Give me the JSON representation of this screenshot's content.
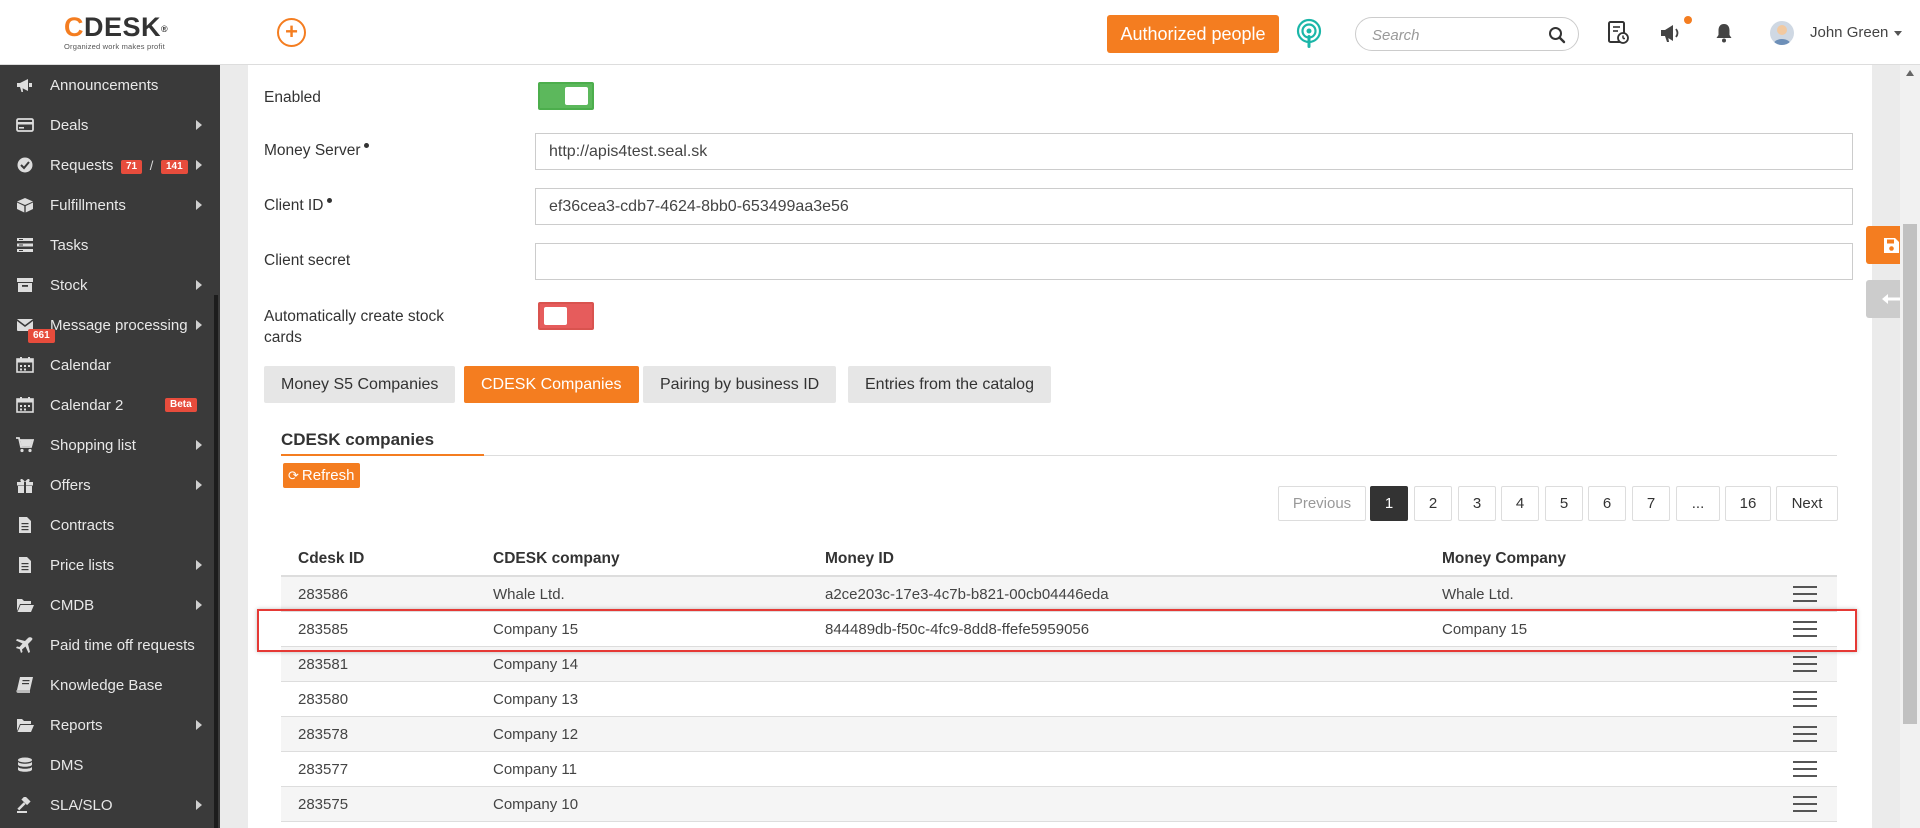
{
  "header": {
    "logo_text": "DESK",
    "logo_c": "C",
    "logo_reg": "®",
    "logo_tagline": "Organized work makes profit",
    "add_symbol": "+",
    "authorized_label": "Authorized people",
    "search_placeholder": "Search",
    "user_name": "John Green"
  },
  "sidebar": {
    "items": [
      {
        "label": "Announcements",
        "icon": "megaphone-icon"
      },
      {
        "label": "Deals",
        "icon": "card-icon"
      },
      {
        "label": "Requests",
        "icon": "check-circle-icon",
        "badge_a": "71",
        "sep": "/",
        "badge_b": "141"
      },
      {
        "label": "Fulfillments",
        "icon": "box-icon"
      },
      {
        "label": "Tasks",
        "icon": "list-icon"
      },
      {
        "label": "Stock",
        "icon": "archive-icon"
      },
      {
        "label": "Message processing",
        "icon": "envelope-icon",
        "badge": "661"
      },
      {
        "label": "Calendar",
        "icon": "calendar-icon"
      },
      {
        "label": "Calendar 2",
        "icon": "calendar-icon",
        "badge": "Beta"
      },
      {
        "label": "Shopping list",
        "icon": "cart-icon"
      },
      {
        "label": "Offers",
        "icon": "gift-icon"
      },
      {
        "label": "Contracts",
        "icon": "document-icon"
      },
      {
        "label": "Price lists",
        "icon": "document-icon"
      },
      {
        "label": "CMDB",
        "icon": "folder-open-icon"
      },
      {
        "label": "Paid time off requests",
        "icon": "plane-icon"
      },
      {
        "label": "Knowledge Base",
        "icon": "book-icon"
      },
      {
        "label": "Reports",
        "icon": "folder-open-icon"
      },
      {
        "label": "DMS",
        "icon": "database-icon"
      },
      {
        "label": "SLA/SLO",
        "icon": "gavel-icon"
      }
    ]
  },
  "form": {
    "enabled_label": "Enabled",
    "enabled_value": true,
    "money_server_label": "Money Server",
    "money_server_value": "http://apis4test.seal.sk",
    "client_id_label": "Client ID",
    "client_id_value": "ef36cea3-cdb7-4624-8bb0-653499aa3e56",
    "client_secret_label": "Client secret",
    "client_secret_value": "",
    "auto_stock_label": "Automatically create stock cards",
    "auto_stock_value": false
  },
  "tabs": [
    {
      "label": "Money S5 Companies",
      "active": false
    },
    {
      "label": "CDESK Companies",
      "active": true
    },
    {
      "label": "Pairing by business ID",
      "active": false
    },
    {
      "label": "Entries from the catalog",
      "active": false
    }
  ],
  "section": {
    "title": "CDESK companies",
    "refresh_label": "Refresh"
  },
  "pagination": {
    "previous": "Previous",
    "pages": [
      "1",
      "2",
      "3",
      "4",
      "5",
      "6",
      "7",
      "...",
      "16"
    ],
    "current": "1",
    "next": "Next"
  },
  "table": {
    "columns": [
      "Cdesk ID",
      "CDESK company",
      "Money ID",
      "Money Company"
    ],
    "rows": [
      {
        "cdesk_id": "283586",
        "cdesk_company": "Whale Ltd.",
        "money_id": "a2ce203c-17e3-4c7b-b821-00cb04446eda",
        "money_company": "Whale Ltd."
      },
      {
        "cdesk_id": "283585",
        "cdesk_company": "Company 15",
        "money_id": "844489db-f50c-4fc9-8dd8-ffefe5959056",
        "money_company": "Company 15",
        "highlighted": true
      },
      {
        "cdesk_id": "283581",
        "cdesk_company": "Company 14",
        "money_id": "",
        "money_company": ""
      },
      {
        "cdesk_id": "283580",
        "cdesk_company": "Company 13",
        "money_id": "",
        "money_company": ""
      },
      {
        "cdesk_id": "283578",
        "cdesk_company": "Company 12",
        "money_id": "",
        "money_company": ""
      },
      {
        "cdesk_id": "283577",
        "cdesk_company": "Company 11",
        "money_id": "",
        "money_company": ""
      },
      {
        "cdesk_id": "283575",
        "cdesk_company": "Company 10",
        "money_id": "",
        "money_company": ""
      }
    ]
  },
  "colors": {
    "accent": "#f47d20",
    "sidebar_bg": "#3a3a3a",
    "toggle_on": "#5cb85c",
    "toggle_off": "#e65c5c",
    "badge_red": "#e74c3c",
    "highlight_border": "#e53935"
  }
}
